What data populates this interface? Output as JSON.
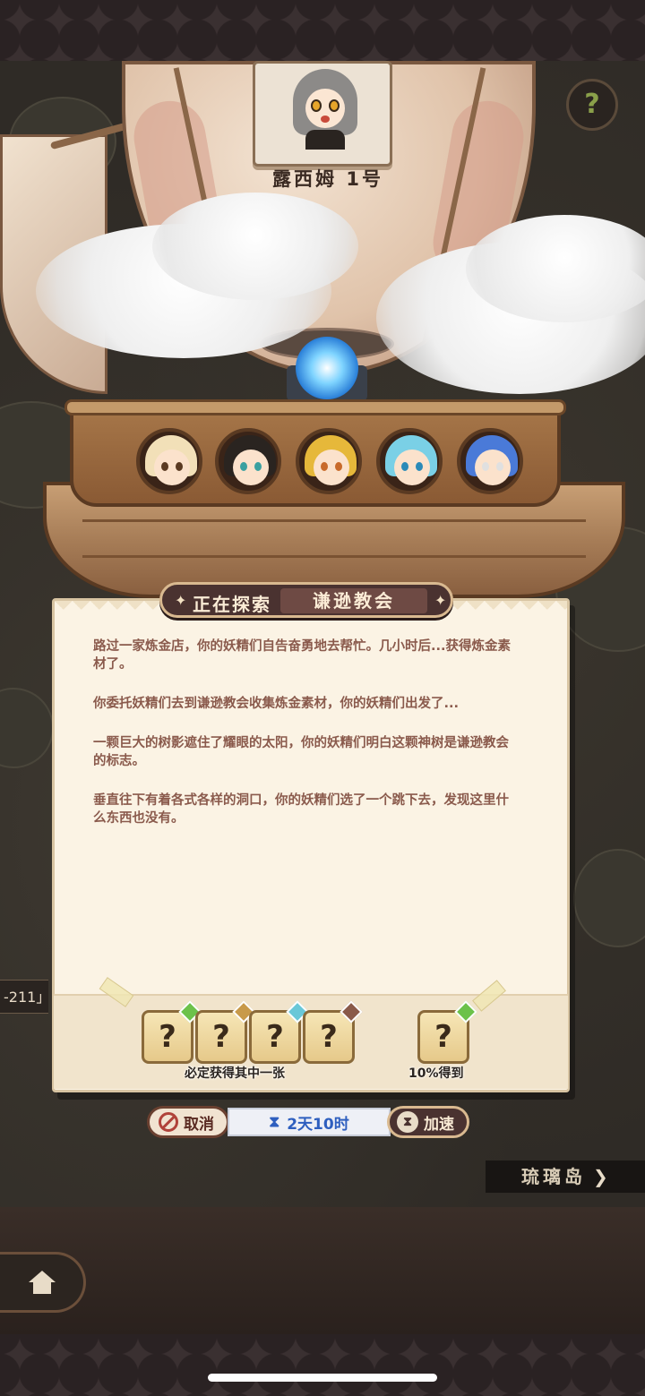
{
  "airship": {
    "name": "露西姆 1号"
  },
  "expedition": {
    "status_label": "正在探索",
    "destination": "谦逊教会",
    "log": [
      "路过一家炼金店，你的妖精们自告奋勇地去帮忙。几小时后...获得炼金素材了。",
      "你委托妖精们去到谦逊教会收集炼金素材，你的妖精们出发了...",
      "一颗巨大的树影遮住了耀眼的太阳，你的妖精们明白这颗神树是谦逊教会的标志。",
      "垂直往下有着各式各样的洞口，你的妖精们选了一个跳下去，发现这里什么东西也没有。"
    ],
    "rewards": {
      "guaranteed_label": "必定获得其中一张",
      "chance_label": "10%得到",
      "card_glyph": "?",
      "gem_colors": [
        "#6cc24a",
        "#c89a4a",
        "#6ac8d8",
        "#8a5a4a",
        "#6cc24a"
      ]
    },
    "crew": [
      {
        "name": "crew-1",
        "hair": "#f2e0b8",
        "eye": "#5a3a22"
      },
      {
        "name": "crew-2",
        "hair": "#2a2420",
        "eye": "#3aa0a0"
      },
      {
        "name": "crew-3",
        "hair": "#e6b83a",
        "eye": "#c86a2a"
      },
      {
        "name": "crew-4",
        "hair": "#7ad0e6",
        "eye": "#2a8ab8"
      },
      {
        "name": "crew-5",
        "hair": "#4a7ad8",
        "eye": "#e0e0e0"
      }
    ]
  },
  "controls": {
    "cancel_label": "取消",
    "timer": "2天10时",
    "speedup_label": "加速"
  },
  "map": {
    "left_label": "-211」",
    "next_island": "琉璃岛",
    "next_arrow": "❯"
  },
  "colors": {
    "accent": "#4a3230",
    "timer_text": "#2e5fbf",
    "log_text": "#8a5a4c"
  }
}
